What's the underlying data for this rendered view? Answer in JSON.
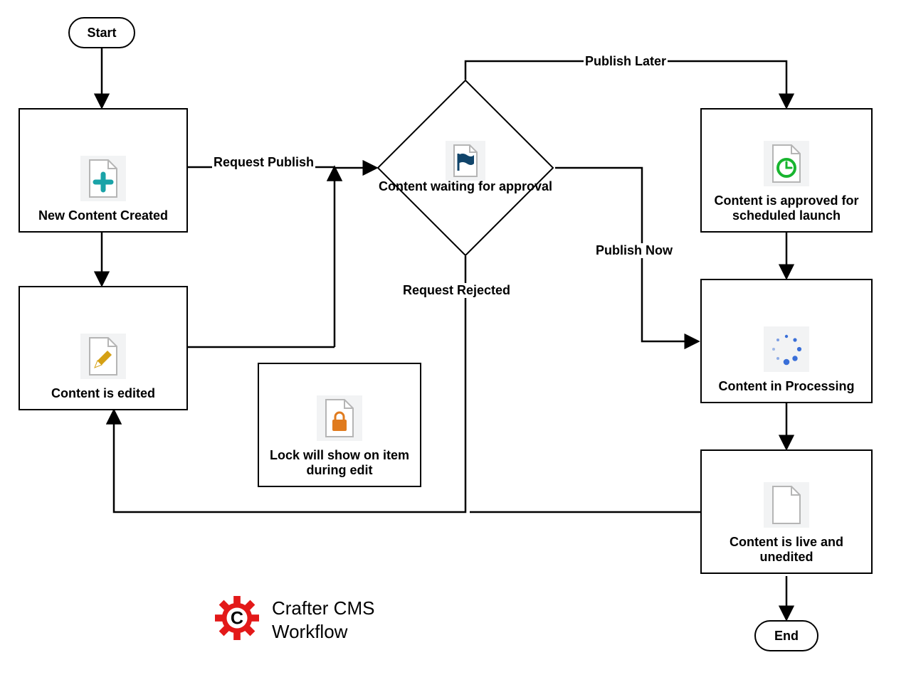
{
  "terminators": {
    "start": "Start",
    "end": "End"
  },
  "nodes": {
    "new_content_created": "New Content Created",
    "content_edited": "Content is edited",
    "lock_note": "Lock will show on item during edit",
    "content_waiting_approval": "Content waiting for approval",
    "approved_scheduled": "Content is approved for scheduled launch",
    "content_processing": "Content in Processing",
    "content_live": "Content is live and unedited"
  },
  "edges": {
    "request_publish": "Request Publish",
    "publish_later": "Publish Later",
    "publish_now": "Publish Now",
    "request_rejected": "Request Rejected"
  },
  "title": {
    "line1": "Crafter CMS",
    "line2": "Workflow"
  },
  "icons": {
    "plus": "plus-icon",
    "pencil": "pencil-icon",
    "lock": "lock-icon",
    "flag": "flag-icon",
    "clock": "clock-icon",
    "spinner": "spinner-icon",
    "page": "page-icon",
    "gear_c": "crafter-gear-icon"
  },
  "colors": {
    "teal": "#1aa3a8",
    "gold": "#d5a014",
    "orange": "#e07b1e",
    "navy": "#10446a",
    "green": "#18b52f",
    "blue": "#3a6fd8",
    "grey": "#b5b5b5",
    "red": "#e31919"
  }
}
